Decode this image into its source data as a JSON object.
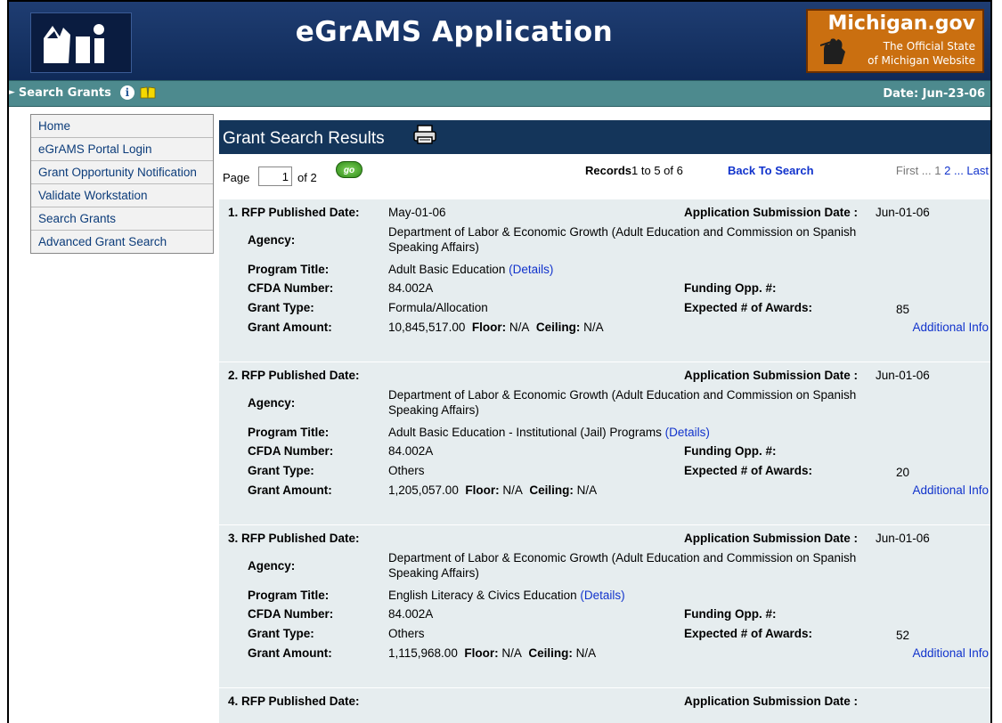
{
  "header": {
    "app_title": "eGrAMS Application",
    "brand_name": "Michigan.gov",
    "brand_tagline_1": "The Official State",
    "brand_tagline_2": "of Michigan Website"
  },
  "navbar": {
    "section": "Search Grants",
    "date": "Date: Jun-23-06"
  },
  "sidebar": {
    "items": [
      {
        "label": "Home"
      },
      {
        "label": "eGrAMS Portal Login"
      },
      {
        "label": "Grant Opportunity Notification"
      },
      {
        "label": "Validate Workstation"
      },
      {
        "label": "Search Grants"
      },
      {
        "label": "Advanced Grant Search"
      }
    ]
  },
  "results": {
    "title": "Grant Search Results",
    "page_label": "Page",
    "page_value": "1",
    "of_label": "of 2",
    "go_label": "go",
    "records_label": "Records",
    "records_range": "1 to 5 of 6",
    "back_label": "Back To Search",
    "pager_first": "First ... ",
    "pager_1": "1",
    "pager_2": "2",
    "pager_last": "... Last"
  },
  "labels": {
    "rfp_date": "RFP Published Date:",
    "app_date": "Application Submission Date :",
    "agency": "Agency:",
    "program": "Program Title:",
    "cfda": "CFDA Number:",
    "funding": "Funding Opp. #:",
    "grant_type": "Grant Type:",
    "awards": "Expected # of Awards:",
    "amount": "Grant Amount:",
    "floor": "Floor:",
    "ceiling": "Ceiling:",
    "details": "(Details)",
    "additional": "Additional Info"
  },
  "records": [
    {
      "num": "1.",
      "rfp_date": "May-01-06",
      "app_date": "Jun-01-06",
      "agency_1": "Department of Labor & Economic Growth (Adult Education and Commission on Spanish",
      "agency_2": "Speaking Affairs)",
      "program": "Adult Basic Education",
      "cfda": "84.002A",
      "funding": "",
      "grant_type": "Formula/Allocation",
      "awards": "85",
      "amount": "10,845,517.00",
      "floor": "N/A",
      "ceiling": "N/A"
    },
    {
      "num": "2.",
      "rfp_date": "",
      "app_date": "Jun-01-06",
      "agency_1": "Department of Labor & Economic Growth (Adult Education and Commission on Spanish",
      "agency_2": "Speaking Affairs)",
      "program": "Adult Basic Education - Institutional (Jail) Programs",
      "cfda": "84.002A",
      "funding": "",
      "grant_type": "Others",
      "awards": "20",
      "amount": "1,205,057.00",
      "floor": "N/A",
      "ceiling": "N/A"
    },
    {
      "num": "3.",
      "rfp_date": "",
      "app_date": "Jun-01-06",
      "agency_1": "Department of Labor & Economic Growth (Adult Education and Commission on Spanish",
      "agency_2": "Speaking Affairs)",
      "program": "English Literacy & Civics Education",
      "cfda": "84.002A",
      "funding": "",
      "grant_type": "Others",
      "awards": "52",
      "amount": "1,115,968.00",
      "floor": "N/A",
      "ceiling": "N/A"
    },
    {
      "num": "4.",
      "rfp_date": "",
      "app_date": ""
    }
  ]
}
